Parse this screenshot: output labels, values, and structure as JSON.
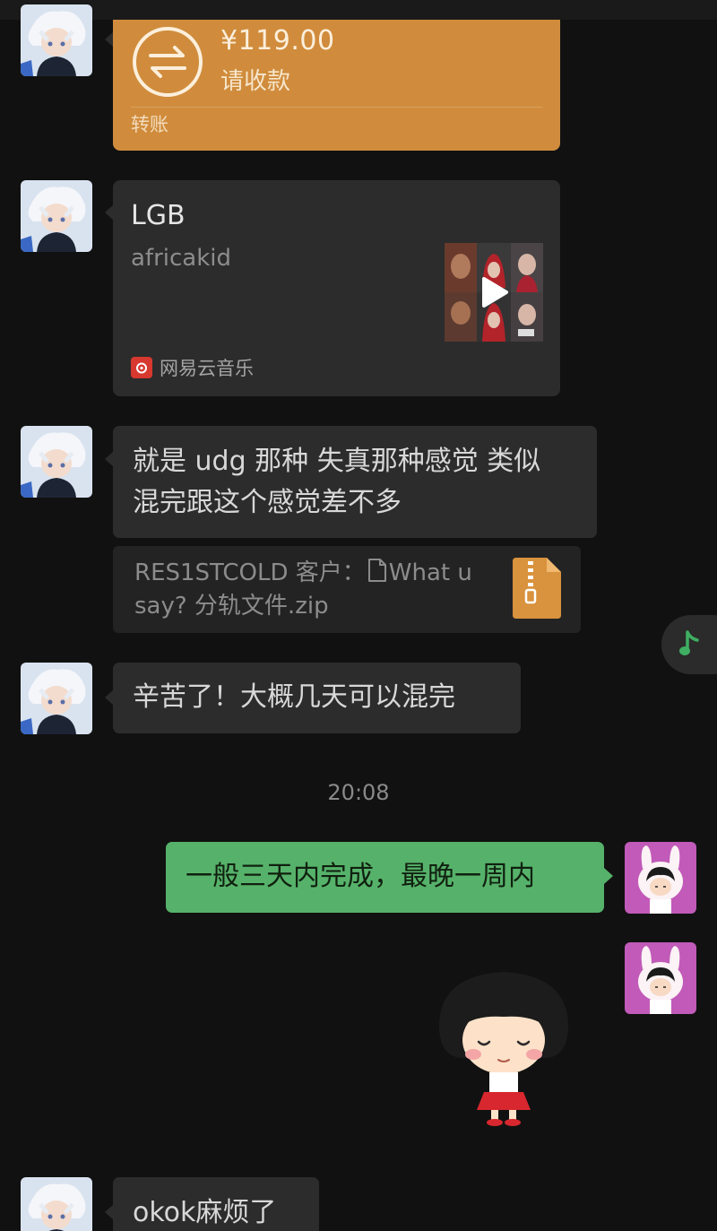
{
  "messages": {
    "transfer": {
      "amount": "¥119.00",
      "status": "请收款",
      "label": "转账",
      "icon": "transfer-arrows-icon",
      "color": "#d08c3c"
    },
    "music": {
      "title": "LGB",
      "artist": "africakid",
      "source": "网易云音乐",
      "source_icon": "netease-music-icon",
      "play_icon": "play-icon"
    },
    "text1": {
      "line1": "就是 udg 那种 失真那种感觉 类似",
      "line2": "混完跟这个感觉差不多"
    },
    "file_quote": {
      "text_before": "RES1STCOLD 客户：",
      "text_after": "What u say? 分轨文件.zip",
      "file_icon": "document-icon",
      "zip_icon": "zip-file-icon"
    },
    "text2": "辛苦了！大概几天可以混完",
    "timestamp": "20:08",
    "reply": {
      "text": "一般三天内完成，最晚一周内",
      "color": "#56b26a"
    },
    "sticker": {
      "icon": "maruko-sticker-icon"
    },
    "text3": "okok麻烦了"
  },
  "floating": {
    "icon": "music-note-icon",
    "color": "#3fae62"
  },
  "avatars": {
    "contact": "contact-avatar",
    "self": "self-avatar"
  }
}
